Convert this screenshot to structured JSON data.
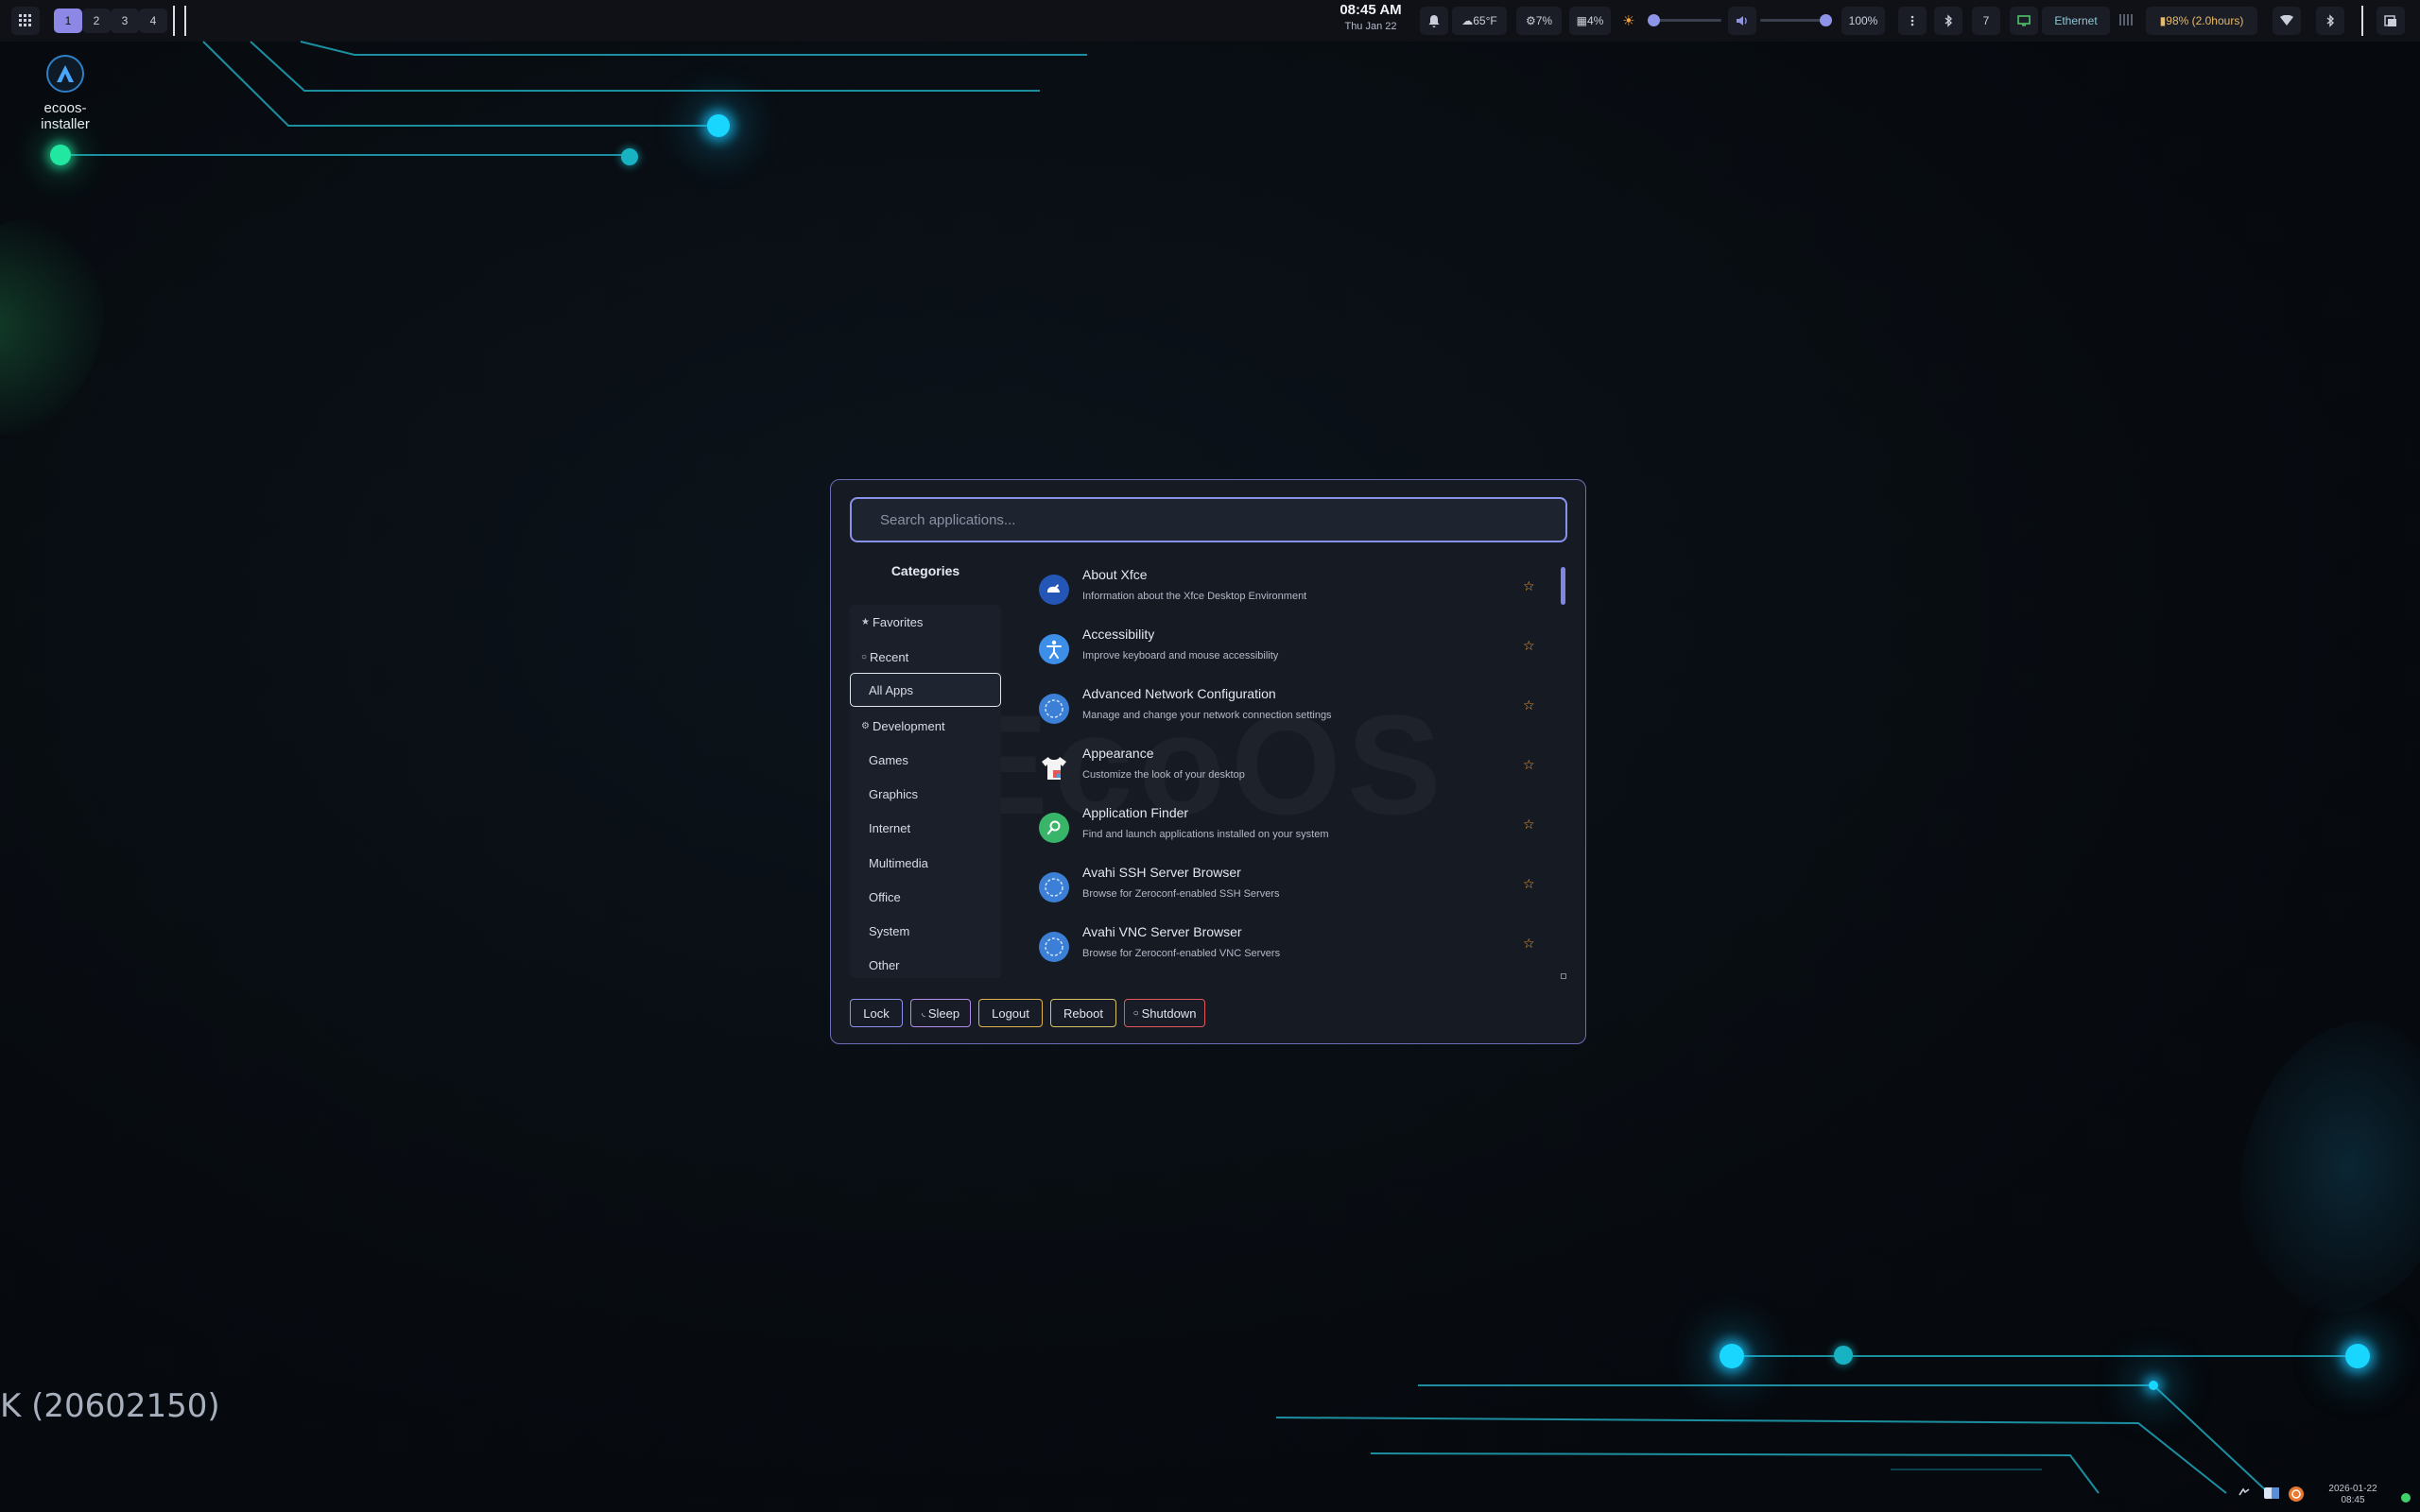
{
  "top_panel": {
    "app_menu_icon": "grid-icon",
    "workspaces": [
      "1",
      "2",
      "3",
      "4"
    ],
    "active_workspace": "1",
    "clock_time": "08:45 AM",
    "clock_date": "Thu Jan 22",
    "weather": "☁65°F",
    "cpu": "⚙7%",
    "memory": "▦4%",
    "volume_percent": "100%",
    "brightness_level": 0,
    "volume_level": 1.0,
    "network_label": "Ethernet",
    "battery": "▮98% (2.0hours)",
    "indicator_seven": "7"
  },
  "desktop": {
    "icon_label": "ecoos-installer",
    "build_text": "K (20602150)"
  },
  "launcher": {
    "search_placeholder": "Search applications...",
    "categories_title": "Categories",
    "watermark": "EcoOS",
    "categories": [
      {
        "label": "Favorites",
        "glyph": "★"
      },
      {
        "label": "Recent",
        "glyph": "○"
      },
      {
        "label": "All Apps",
        "glyph": ""
      },
      {
        "label": "Development",
        "glyph": "⚙"
      },
      {
        "label": "Games",
        "glyph": ""
      },
      {
        "label": "Graphics",
        "glyph": ""
      },
      {
        "label": "Internet",
        "glyph": ""
      },
      {
        "label": "Multimedia",
        "glyph": ""
      },
      {
        "label": "Office",
        "glyph": ""
      },
      {
        "label": "System",
        "glyph": ""
      },
      {
        "label": "Other",
        "glyph": ""
      }
    ],
    "active_category": "All Apps",
    "apps": [
      {
        "name": "About Xfce",
        "desc": "Information about the Xfce Desktop Environment",
        "icon": "xfce-mouse-icon",
        "color": "#2456b8"
      },
      {
        "name": "Accessibility",
        "desc": "Improve keyboard and mouse accessibility",
        "icon": "accessibility-icon",
        "color": "#3d8ee8"
      },
      {
        "name": "Advanced Network Configuration",
        "desc": "Manage and change your network connection settings",
        "icon": "network-globe-icon",
        "color": "#3b7fd6"
      },
      {
        "name": "Appearance",
        "desc": "Customize the look of your desktop",
        "icon": "shirt-icon",
        "color": "#f2f2f2"
      },
      {
        "name": "Application Finder",
        "desc": "Find and launch applications installed on your system",
        "icon": "magnifier-icon",
        "color": "#39b56a"
      },
      {
        "name": "Avahi SSH Server Browser",
        "desc": "Browse for Zeroconf-enabled SSH Servers",
        "icon": "avahi-globe-icon",
        "color": "#3b7fd6"
      },
      {
        "name": "Avahi VNC Server Browser",
        "desc": "Browse for Zeroconf-enabled VNC Servers",
        "icon": "avahi-globe-icon",
        "color": "#3b7fd6"
      }
    ],
    "favorite_glyph": "☆",
    "actions": [
      {
        "label": "Lock",
        "glyph": "",
        "color": "#8a90e8"
      },
      {
        "label": "Sleep",
        "glyph": "◟",
        "color": "#b48ce8"
      },
      {
        "label": "Logout",
        "glyph": "",
        "color": "#e0b24a"
      },
      {
        "label": "Reboot",
        "glyph": "",
        "color": "#d8c068"
      },
      {
        "label": "Shutdown",
        "glyph": "○",
        "color": "#e0585a"
      }
    ]
  },
  "tray": {
    "date": "2026-01-22",
    "time": "08:45"
  }
}
